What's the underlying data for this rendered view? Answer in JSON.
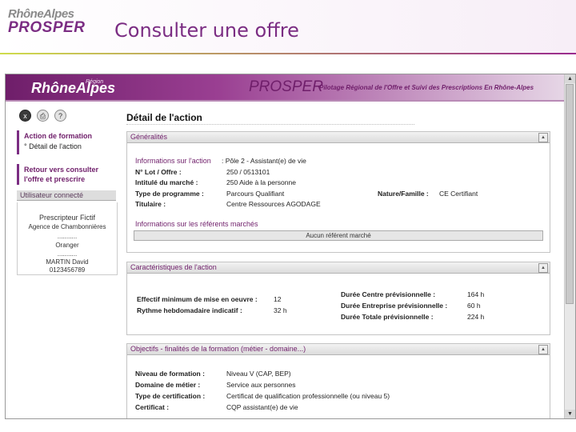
{
  "slide": {
    "logo_top": "RhôneAlpes",
    "logo_main": "PROSPER",
    "title": "Consulter une offre"
  },
  "banner": {
    "logo": "RhôneAlpes",
    "logo_sup": "Région",
    "app_name": "PROSPER",
    "tagline": "Pilotage Régional de l'Offre et Suivi des Prescriptions En Rhône-Alpes"
  },
  "toolbar": {
    "close_label": "x",
    "print_label": "⎙",
    "help_label": "?"
  },
  "nav": {
    "items": [
      {
        "label": "Action de formation"
      },
      {
        "label": "° Détail de l'action"
      }
    ],
    "back_line1": "Retour vers consulter",
    "back_line2": "l'offre et prescrire"
  },
  "user": {
    "header": "Utilisateur connecté",
    "lines": [
      "Prescripteur Fictif",
      "Agence de Chambonnières",
      "...........",
      "Oranger",
      "...........",
      "MARTIN David",
      "0123456789"
    ]
  },
  "page_title": "Détail de l'action",
  "sections": {
    "generalites": {
      "title": "Généralités",
      "info_head": "Informations sur l'action",
      "pole": ": Pôle 2 - Assistant(e) de vie",
      "fields": {
        "lot_label": "N° Lot / Offre :",
        "lot_value": "250 / 0513101",
        "intitule_label": "Intitulé du marché :",
        "intitule_value": "250 Aide à la personne",
        "type_label": "Type de programme :",
        "type_value": "Parcours Qualifiant",
        "titulaire_label": "Titulaire :",
        "titulaire_value": "Centre Ressources AGODAGE",
        "nature_label": "Nature/Famille :",
        "nature_value": "CE  Certifiant"
      },
      "ref_head": "Informations sur les référents marchés",
      "ref_none": "Aucun référent marché"
    },
    "caracteristiques": {
      "title": "Caractéristiques de l'action",
      "effectif_label": "Effectif minimum de mise en oeuvre :",
      "effectif_value": "12",
      "rythme_label": "Rythme hebdomadaire indicatif :",
      "rythme_value": "32 h",
      "centre_label": "Durée Centre prévisionnelle :",
      "centre_value": "164 h",
      "entreprise_label": "Durée Entreprise prévisionnelle :",
      "entreprise_value": "60 h",
      "totale_label": "Durée Totale prévisionnelle :",
      "totale_value": "224 h"
    },
    "objectifs": {
      "title": "Objectifs - finalités de la formation (métier - domaine...)",
      "niveau_label": "Niveau de formation :",
      "niveau_value": "Niveau V (CAP, BEP)",
      "domaine_label": "Domaine de métier :",
      "domaine_value": "Service aux personnes",
      "typecert_label": "Type de certification :",
      "typecert_value": "Certificat de qualification professionnelle (ou niveau 5)",
      "cert_label": "Certificat :",
      "cert_value": "CQP assistant(e) de vie"
    }
  },
  "colors": {
    "brand_purple": "#7b2d83",
    "accent_green": "#cfdc4c"
  }
}
